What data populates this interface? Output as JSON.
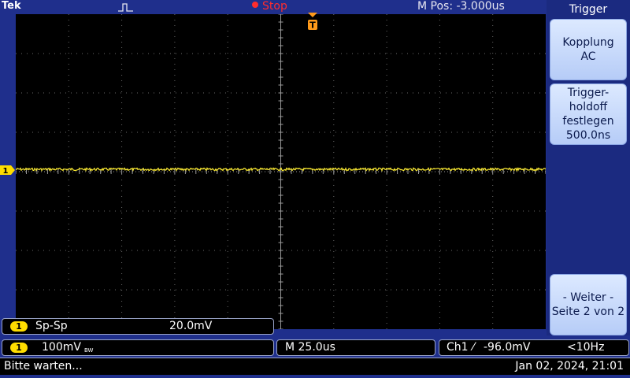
{
  "header": {
    "brand": "Tek",
    "run_state": "Stop",
    "horizontal_position": "M Pos: -3.000us"
  },
  "display": {
    "trigger_marker_label": "T",
    "channel_marker_label": "1"
  },
  "side_menu": {
    "title": "Trigger",
    "buttons": [
      {
        "line1": "Kopplung",
        "line2": "AC"
      },
      {
        "line1": "Trigger-",
        "line2": "holdoff",
        "line3": "festlegen",
        "line4": "500.0ns"
      },
      {
        "line1": "- Weiter -",
        "line2": "Seite 2 von 2"
      }
    ]
  },
  "measurement": {
    "channel": "1",
    "name": "Sp-Sp",
    "value": "20.0mV"
  },
  "channel_readout": {
    "channel": "1",
    "scale": "100mV",
    "bandwidth_flag": "BW"
  },
  "timebase": {
    "label": "M 25.0us"
  },
  "trigger_readout": {
    "source": "Ch1",
    "slope_symbol": "⁄",
    "level": "-96.0mV",
    "frequency": "<10Hz"
  },
  "status": {
    "message": "Bitte warten...",
    "datetime": "Jan 02, 2024, 21:01"
  },
  "colors": {
    "background": "#1f2f8c",
    "trace_ch1": "#ffee33",
    "graticule": "#6a6a6a",
    "trigger_marker": "#ff9a1a"
  }
}
